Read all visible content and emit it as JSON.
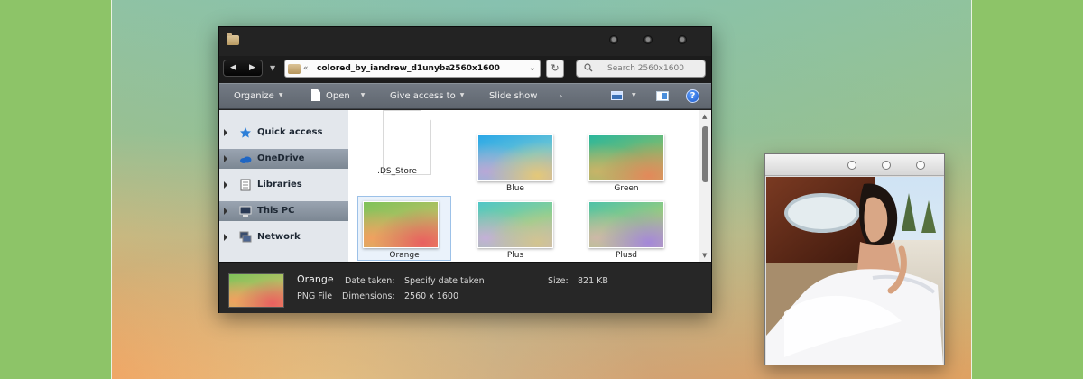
{
  "explorer": {
    "address": {
      "crumbs": [
        "colored_by_iandrew_d1unyba",
        "2560x1600"
      ],
      "chevron": "«",
      "separator": "›"
    },
    "search": {
      "placeholder": "Search 2560x1600"
    },
    "toolbar": {
      "organize": "Organize",
      "open": "Open",
      "give_access": "Give access to",
      "slideshow": "Slide show",
      "help": "?"
    },
    "nav": [
      {
        "label": "Quick access",
        "icon": "star-icon",
        "selected": false
      },
      {
        "label": "OneDrive",
        "icon": "cloud-icon",
        "selected": true
      },
      {
        "label": "Libraries",
        "icon": "library-icon",
        "selected": false
      },
      {
        "label": "This PC",
        "icon": "computer-icon",
        "selected": true
      },
      {
        "label": "Network",
        "icon": "network-icon",
        "selected": false
      }
    ],
    "files": [
      {
        "name": ".DS_Store",
        "kind": "document"
      },
      {
        "name": "Blue",
        "kind": "image",
        "colors": [
          "#2aa7e8",
          "#6cc6d4",
          "#b9a7d6",
          "#e4c878"
        ]
      },
      {
        "name": "Green",
        "kind": "image",
        "colors": [
          "#2ab79d",
          "#7dbb6e",
          "#c9b368",
          "#e2895a"
        ]
      },
      {
        "name": "Orange",
        "kind": "image",
        "colors": [
          "#7ec25a",
          "#b7c064",
          "#f0a060",
          "#e86060"
        ],
        "selected": true
      },
      {
        "name": "Plus",
        "kind": "image",
        "colors": [
          "#50c6c8",
          "#8ed08e",
          "#c4b0d8",
          "#d2c490"
        ]
      },
      {
        "name": "Plusd",
        "kind": "image",
        "colors": [
          "#4fc2a8",
          "#9ccc7c",
          "#cdb8a8",
          "#a488d8"
        ]
      }
    ],
    "details": {
      "name": "Orange",
      "type": "PNG File",
      "date_label": "Date taken:",
      "date_value": "Specify date taken",
      "size_label": "Size:",
      "size_value": "821 KB",
      "dims_label": "Dimensions:",
      "dims_value": "2560 x 1600"
    }
  },
  "colors": {
    "accent": "#1b58c8",
    "toolbar": "#6a717a",
    "nav_selected": "#8893a0"
  }
}
